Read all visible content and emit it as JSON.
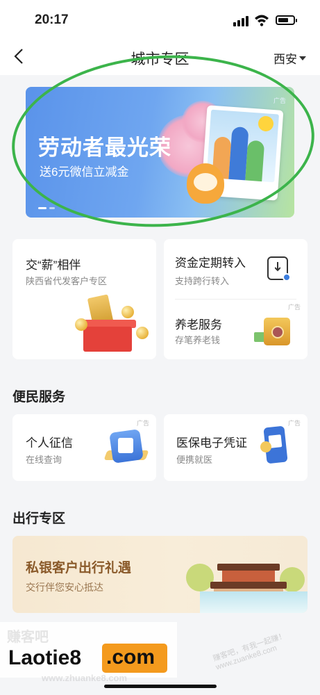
{
  "status_bar": {
    "time": "20:17"
  },
  "header": {
    "title": "城市专区",
    "city": "西安"
  },
  "banner": {
    "title": "劳动者最光荣",
    "subtitle": "送6元微信立减金",
    "ad_label": "广告"
  },
  "cards": {
    "salary": {
      "title": "交“薪”相伴",
      "subtitle": "陕西省代发客户专区"
    },
    "transfer": {
      "title": "资金定期转入",
      "subtitle": "支持跨行转入"
    },
    "pension": {
      "title": "养老服务",
      "subtitle": "存笔养老钱",
      "ad_label": "广告"
    }
  },
  "services": {
    "section_title": "便民服务",
    "credit": {
      "title": "个人征信",
      "subtitle": "在线查询",
      "ad_label": "广告"
    },
    "medical": {
      "title": "医保电子凭证",
      "subtitle": "便携就医",
      "ad_label": "广告"
    }
  },
  "travel": {
    "section_title": "出行专区",
    "title": "私银客户出行礼遇",
    "subtitle": "交行伴您安心抵达"
  },
  "watermark": {
    "brand": "Laotie8",
    "domain": ".com",
    "faint_text": "赚客吧",
    "faint_url": "www.zhuanke8.com",
    "right_text": "赚客吧，有我一起赚！www.zuanke8.com"
  },
  "colors": {
    "accent_blue": "#3b7ddd",
    "highlight_circle": "#3cb44b",
    "watermark_orange": "#f49a1d"
  }
}
